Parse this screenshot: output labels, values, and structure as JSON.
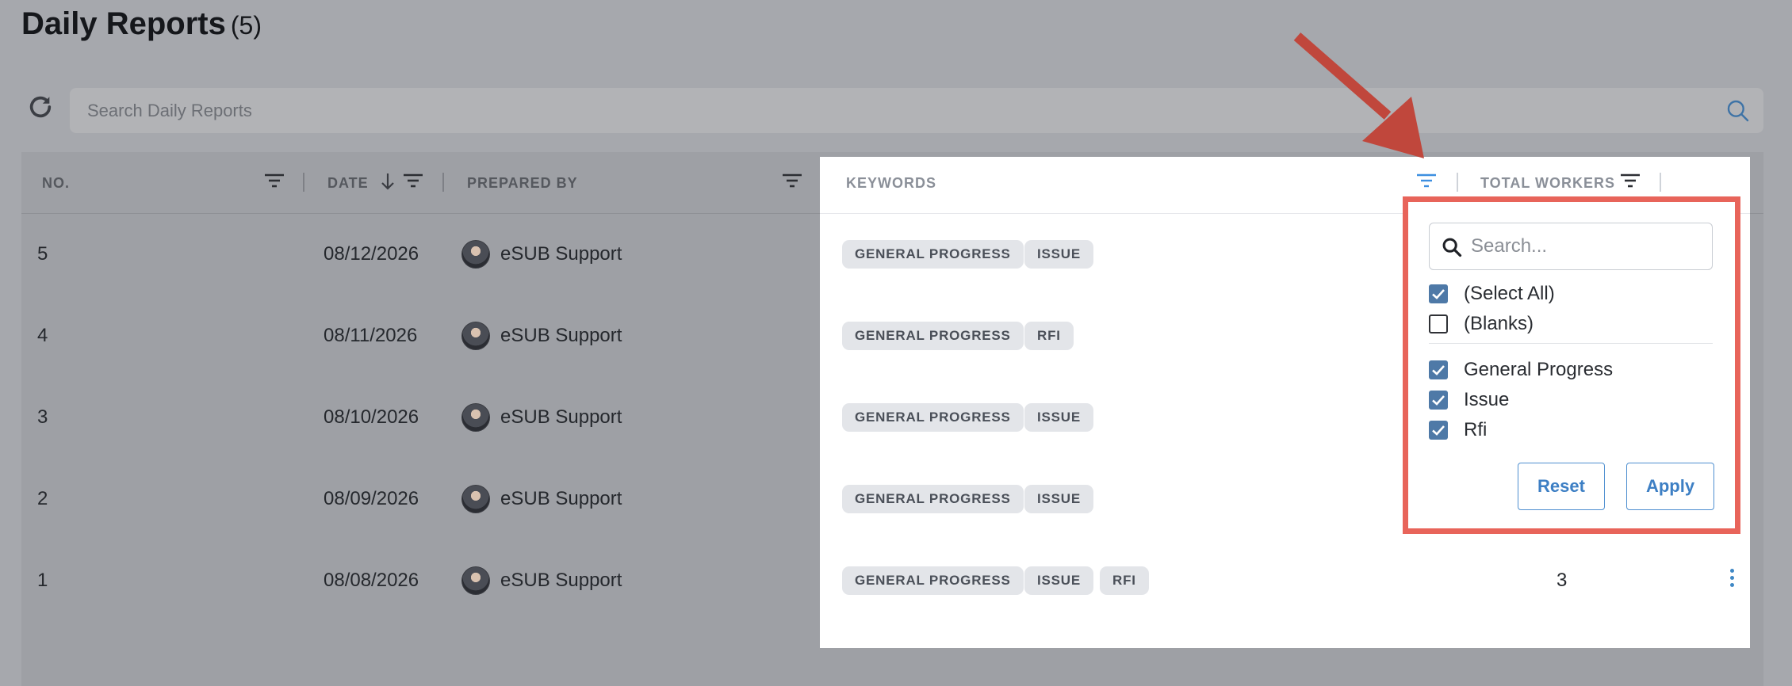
{
  "page": {
    "title": "Daily Reports",
    "count": "(5)"
  },
  "search": {
    "placeholder": "Search Daily Reports"
  },
  "table": {
    "columns": {
      "no": "NO.",
      "date": "DATE",
      "prepared_by": "PREPARED BY",
      "keywords": "KEYWORDS",
      "total_workers": "TOTAL WORKERS"
    },
    "rows": [
      {
        "no": "5",
        "date": "08/12/2026",
        "prepared_by": "eSUB Support",
        "keywords": [
          "GENERAL PROGRESS",
          "ISSUE"
        ],
        "total_workers": ""
      },
      {
        "no": "4",
        "date": "08/11/2026",
        "prepared_by": "eSUB Support",
        "keywords": [
          "GENERAL PROGRESS",
          "RFI"
        ],
        "total_workers": ""
      },
      {
        "no": "3",
        "date": "08/10/2026",
        "prepared_by": "eSUB Support",
        "keywords": [
          "GENERAL PROGRESS",
          "ISSUE"
        ],
        "total_workers": ""
      },
      {
        "no": "2",
        "date": "08/09/2026",
        "prepared_by": "eSUB Support",
        "keywords": [
          "GENERAL PROGRESS",
          "ISSUE"
        ],
        "total_workers": ""
      },
      {
        "no": "1",
        "date": "08/08/2026",
        "prepared_by": "eSUB Support",
        "keywords": [
          "GENERAL PROGRESS",
          "ISSUE",
          "RFI"
        ],
        "total_workers": "3"
      }
    ]
  },
  "filter_popup": {
    "search_placeholder": "Search...",
    "options": [
      {
        "label": "(Select All)",
        "checked": true
      },
      {
        "label": "(Blanks)",
        "checked": false
      },
      {
        "label": "General Progress",
        "checked": true
      },
      {
        "label": "Issue",
        "checked": true
      },
      {
        "label": "Rfi",
        "checked": true
      }
    ],
    "reset_label": "Reset",
    "apply_label": "Apply"
  },
  "colors": {
    "overlay": "#a6a8ad",
    "highlight_border": "#e8645a",
    "arrow": "#c0473c",
    "accent": "#3d7fc4",
    "checkbox": "#4e79a7"
  },
  "icons": [
    "refresh-icon",
    "search-icon",
    "filter-icon",
    "sort-down-arrow-icon",
    "kebab-menu-icon",
    "checkbox-icon",
    "annotation-arrow"
  ]
}
